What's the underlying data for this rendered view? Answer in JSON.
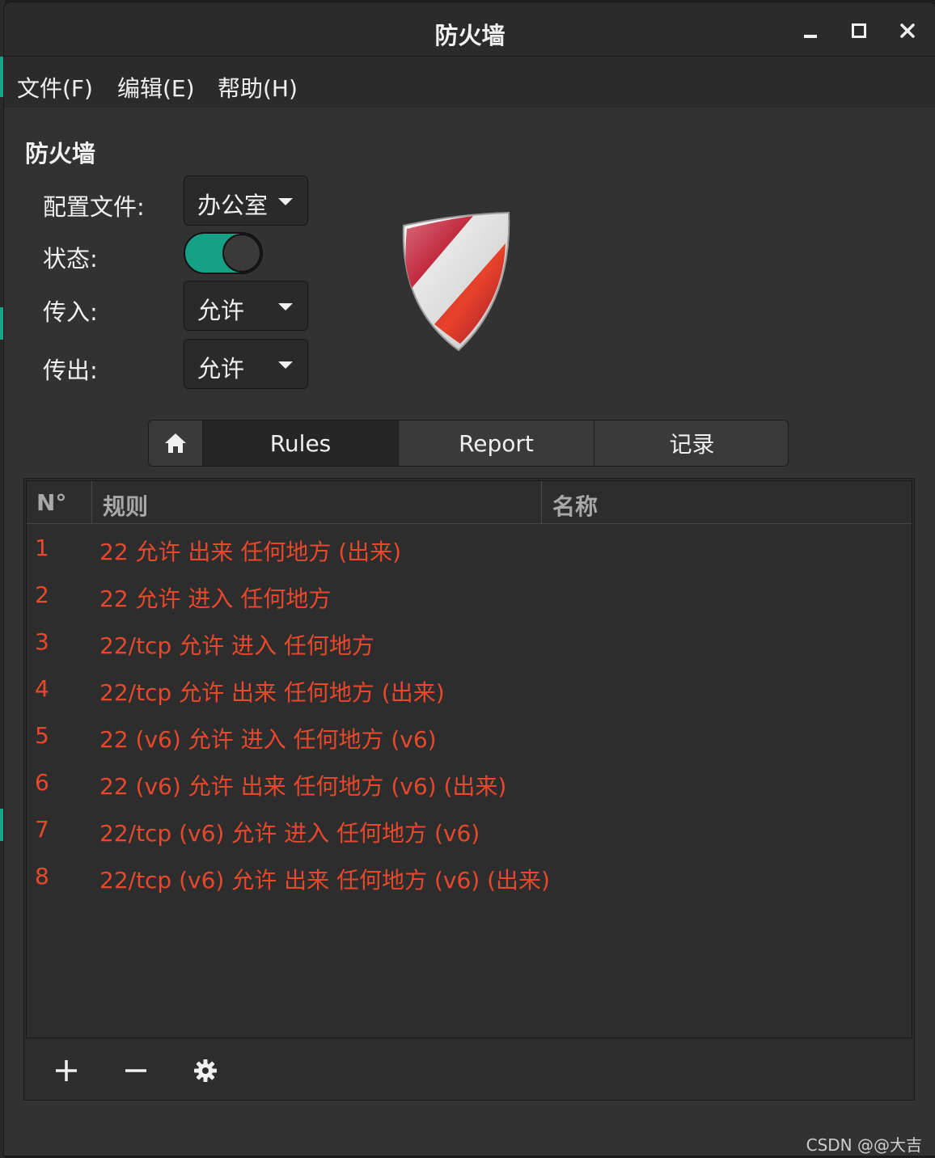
{
  "window": {
    "title": "防火墙"
  },
  "menubar": {
    "items": [
      "文件(F)",
      "编辑(E)",
      "帮助(H)"
    ]
  },
  "section": {
    "title": "防火墙"
  },
  "form": {
    "profile_label": "配置文件:",
    "profile_value": "办公室",
    "status_label": "状态:",
    "status_on": true,
    "incoming_label": "传入:",
    "incoming_value": "允许",
    "outgoing_label": "传出:",
    "outgoing_value": "允许"
  },
  "tabs": {
    "rules": "Rules",
    "report": "Report",
    "log": "记录",
    "active": "rules"
  },
  "table": {
    "headers": [
      "N°",
      "规则",
      "名称"
    ],
    "rows": [
      {
        "num": "1",
        "rule": "22 允许 出来 任何地方 (出来)"
      },
      {
        "num": "2",
        "rule": "22 允许 进入 任何地方"
      },
      {
        "num": "3",
        "rule": "22/tcp 允许 进入 任何地方"
      },
      {
        "num": "4",
        "rule": "22/tcp 允许 出来 任何地方 (出来)"
      },
      {
        "num": "5",
        "rule": "22 (v6) 允许 进入 任何地方 (v6)"
      },
      {
        "num": "6",
        "rule": "22 (v6) 允许 出来 任何地方 (v6) (出来)"
      },
      {
        "num": "7",
        "rule": "22/tcp (v6) 允许 进入 任何地方 (v6)"
      },
      {
        "num": "8",
        "rule": "22/tcp (v6) 允许 出来 任何地方 (v6) (出来)"
      }
    ]
  },
  "toolbar": {
    "icons": [
      "plus-icon",
      "minus-icon",
      "gear-icon"
    ]
  },
  "watermark": "CSDN @@大吉",
  "colors": {
    "accent": "#16a085",
    "rule_text": "#e8482b",
    "background": "#323232"
  }
}
